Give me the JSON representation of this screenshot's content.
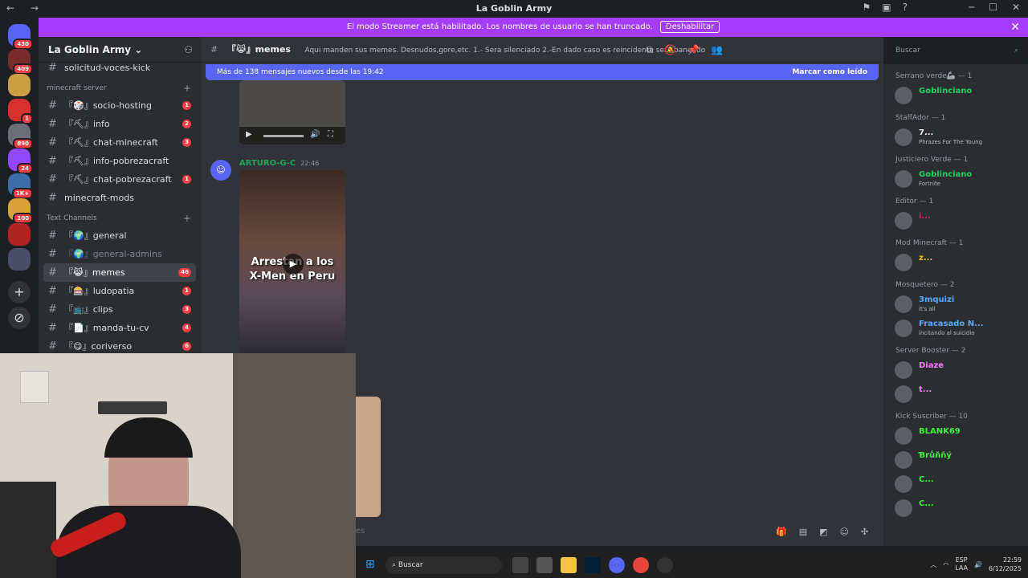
{
  "window": {
    "title": "La Goblin Army"
  },
  "banner": {
    "text": "El modo Streamer está habilitado. Los nombres de usuario se han truncado.",
    "button": "Deshabilitar",
    "close": "✕"
  },
  "servers": [
    {
      "badge": "430",
      "color": "#5865f2"
    },
    {
      "badge": "409",
      "color": "#7a2b2b"
    },
    {
      "badge": "",
      "color": "#c9a043"
    },
    {
      "badge": "1",
      "color": "#d93030"
    },
    {
      "badge": "890",
      "color": "#6d6f78"
    },
    {
      "badge": "24",
      "color": "#9146ff"
    },
    {
      "badge": "1K+",
      "color": "#3b6ea8"
    },
    {
      "badge": "100",
      "color": "#d7a33a"
    },
    {
      "badge": "",
      "color": "#b32222"
    },
    {
      "badge": "",
      "color": "#4a4e69"
    }
  ],
  "sidebar": {
    "guild_name": "La Goblin Army",
    "top_channel": "solicitud-voces-kick",
    "categories": [
      {
        "label": "minecraft server",
        "channels": [
          {
            "name": "『🎲』socio-hosting",
            "count": "1"
          },
          {
            "name": "『⛏』info",
            "count": "2"
          },
          {
            "name": "『⛏』chat-minecraft",
            "count": "3"
          },
          {
            "name": "『⛏』info-pobrezacraft",
            "count": ""
          },
          {
            "name": "『⛏』chat-pobrezacraft",
            "count": "1"
          },
          {
            "name": "minecraft-mods",
            "count": ""
          }
        ]
      },
      {
        "label": "Text Channels",
        "channels": [
          {
            "name": "『🌍』general",
            "count": ""
          },
          {
            "name": "『🌍』general-admins",
            "count": ""
          },
          {
            "name": "『😹』memes",
            "count": "46"
          },
          {
            "name": "『🎰』ludopatia",
            "count": "1"
          },
          {
            "name": "『📺』clips",
            "count": "3"
          },
          {
            "name": "『📄』manda-tu-cv",
            "count": "4"
          },
          {
            "name": "『😋』coriverso",
            "count": "6"
          }
        ]
      }
    ]
  },
  "chat": {
    "channel": "『😹』memes",
    "topic": "Aqui manden sus memes. Desnudos,gore,etc. 1.- Sera silenciado 2.-En dado caso es reincidente sera baneado",
    "new_messages": "Más de 138 mensajes nuevos desde las 19:42",
    "mark_read": "Marcar como leído",
    "message": {
      "author": "ARTURO-G-C",
      "time": "22:46",
      "video_caption_1": "Arrestan a los",
      "video_caption_2": "X-Men en Peru"
    },
    "input_placeholder": "es"
  },
  "search": {
    "placeholder": "Buscar"
  },
  "members": [
    {
      "group": "Serrano verde🦾 — 1",
      "users": [
        {
          "name": "Goblinciano",
          "status": "",
          "color": "#23d160"
        }
      ]
    },
    {
      "group": "StaffAdor — 1",
      "users": [
        {
          "name": "7...",
          "status": "Phrazes For The Young",
          "color": "#f2f3f5"
        }
      ]
    },
    {
      "group": "Justiciero Verde — 1",
      "users": [
        {
          "name": "Goblinciano",
          "status": "Fortnite",
          "color": "#23d160"
        }
      ]
    },
    {
      "group": "Editor — 1",
      "users": [
        {
          "name": "i...",
          "status": "",
          "color": "#e91e63"
        }
      ]
    },
    {
      "group": "Mod Minecraft — 1",
      "users": [
        {
          "name": "z...",
          "status": "",
          "color": "#f1c40f"
        }
      ]
    },
    {
      "group": "Mosquetero — 2",
      "users": [
        {
          "name": "3mquizi",
          "status": "it's all",
          "color": "#5aa9ff"
        },
        {
          "name": "Fracasado N...",
          "status": "incitando al suicidio",
          "color": "#5aa9ff"
        }
      ]
    },
    {
      "group": "Server Booster — 2",
      "users": [
        {
          "name": "Diaze",
          "status": "",
          "color": "#f47fff"
        },
        {
          "name": "t...",
          "status": "",
          "color": "#f47fff"
        }
      ]
    },
    {
      "group": "Kick Suscriber — 10",
      "users": [
        {
          "name": "BLANK69",
          "status": "",
          "color": "#3ef23e"
        },
        {
          "name": "Ɓrůňňý",
          "status": "",
          "color": "#3ef23e"
        },
        {
          "name": "C...",
          "status": "",
          "color": "#3ef23e"
        },
        {
          "name": "C...",
          "status": "",
          "color": "#3ef23e"
        }
      ]
    }
  ],
  "taskbar": {
    "search": "Buscar",
    "lang": "ESP",
    "lang2": "LAA",
    "time": "22:59",
    "date": "6/12/2025"
  }
}
